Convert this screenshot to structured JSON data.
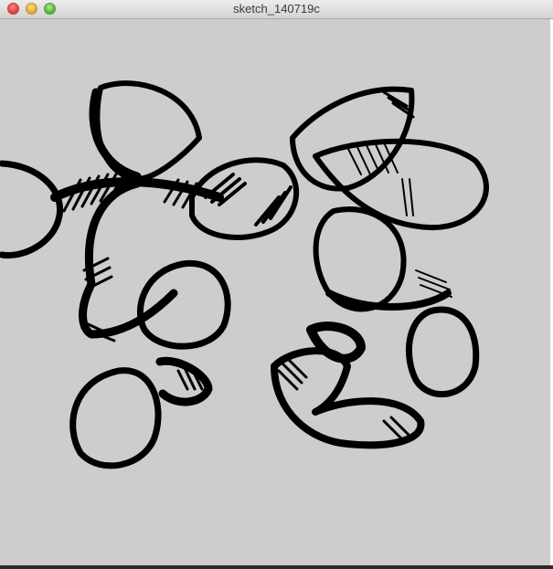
{
  "window": {
    "title": "sketch_140719c",
    "controls": {
      "close": "close-icon",
      "minimize": "minimize-icon",
      "maximize": "maximize-icon"
    }
  },
  "canvas": {
    "background": "#cdcdcd",
    "stroke_color": "#000000"
  }
}
